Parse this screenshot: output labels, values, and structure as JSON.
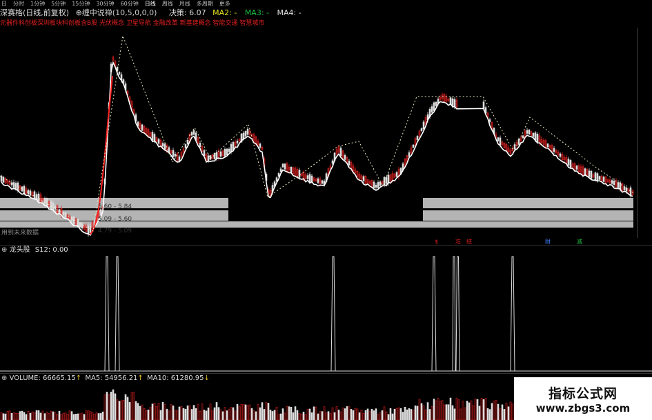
{
  "toolbar": {
    "items": [
      "日",
      "分时",
      "1分钟",
      "5分钟",
      "15分钟",
      "30分钟",
      "60分钟",
      "日线",
      "周线",
      "月线",
      "多周期",
      "更多"
    ],
    "active_index": 7
  },
  "header": {
    "title": "深赛格(日线,前复权)",
    "indicator_name": "缠中说禅(10,5,0,0,0)",
    "decision_label": "决策:",
    "decision_value": "6.07",
    "ma2_label": "MA2:",
    "ma2_value": "-",
    "ma3_label": "MA3:",
    "ma3_value": "-",
    "ma4_label": "MA4:",
    "ma4_value": "-"
  },
  "concepts": "元器件科创板深圳板块科创板含B股 光伏概念 卫星导航 金融改革 新基建概念 智能交通 智慧城市",
  "price_panel": {
    "zone_labels": [
      "5.60 - 5.84",
      "5.09 - 5.60",
      "4.79 - 5.09"
    ],
    "future_label": "用到未来数据",
    "marker_labels": [
      "$",
      "冻",
      "结",
      "财",
      "减"
    ],
    "colors": {
      "up": "#e02020",
      "down": "#dddddd",
      "ma": "#ffffff",
      "ma_red": "#ff2020",
      "zone": "#b4b4b4",
      "black_box": "#000000"
    }
  },
  "signal_panel": {
    "label": "龙头股",
    "value_label": "S12:",
    "value": "0.00"
  },
  "volume_panel": {
    "label": "VOLUME:",
    "volume_value": "66665.15",
    "ma5_label": "MA5:",
    "ma5_value": "54956.21",
    "ma10_label": "MA10:",
    "ma10_value": "61280.95"
  },
  "watermark": {
    "line1": "指标公式网",
    "line2": "www.zbgs3.com"
  }
}
